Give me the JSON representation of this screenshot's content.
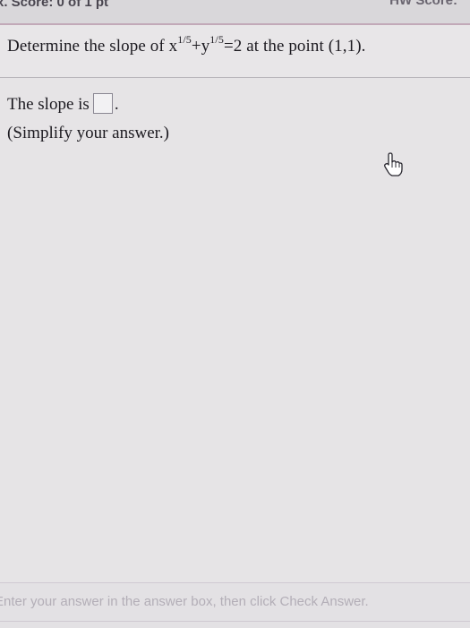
{
  "header": {
    "score_left": "x. Score: 0 of 1 pt",
    "score_right": "HW Score:"
  },
  "question": {
    "prefix": "Determine the slope of x",
    "exp1": "1/5",
    "middle": "+y",
    "exp2": "1/5",
    "suffix": "=2 at the point (1,1)."
  },
  "answer": {
    "prefix": "The slope is",
    "suffix": ".",
    "value": ""
  },
  "hint": "(Simplify your answer.)",
  "footer": {
    "instruction": "Enter your answer in the answer box, then click Check Answer."
  },
  "icons": {
    "cursor": "pointer-hand-icon"
  }
}
